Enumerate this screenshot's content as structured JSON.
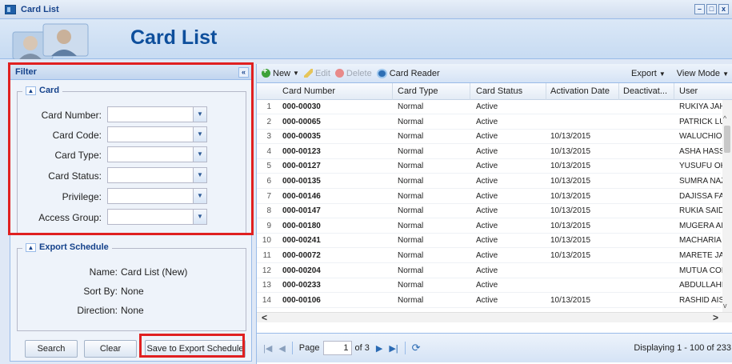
{
  "window": {
    "title": "Card List",
    "icon": "card-list-app-icon",
    "buttons": [
      "–",
      "□",
      "x"
    ]
  },
  "header": {
    "heading": "Card List"
  },
  "filter_panel": {
    "title": "Filter",
    "collapse_glyph": "«",
    "card_section": {
      "legend": "Card",
      "fields": [
        {
          "label": "Card Number:",
          "value": ""
        },
        {
          "label": "Card Code:",
          "value": ""
        },
        {
          "label": "Card Type:",
          "value": ""
        },
        {
          "label": "Card Status:",
          "value": ""
        },
        {
          "label": "Privilege:",
          "value": ""
        },
        {
          "label": "Access Group:",
          "value": ""
        }
      ]
    },
    "export_section": {
      "legend": "Export Schedule",
      "name_label": "Name:",
      "name_value": "Card List (New)",
      "sort_label": "Sort By:",
      "sort_value": "None",
      "direction_label": "Direction:",
      "direction_value": "None"
    },
    "buttons": {
      "search": "Search",
      "clear": "Clear",
      "save_export": "Save to Export Schedule"
    }
  },
  "toolbar": {
    "new": "New",
    "edit": "Edit",
    "delete": "Delete",
    "card_reader": "Card Reader",
    "export": "Export",
    "view_mode": "View Mode"
  },
  "grid": {
    "columns": [
      "Card Number",
      "Card Type",
      "Card Status",
      "Activation Date",
      "Deactivat...",
      "User"
    ],
    "rows": [
      {
        "n": "1",
        "card": "000-00030",
        "type": "Normal",
        "status": "Active",
        "activation": "",
        "deactivation": "",
        "user": "RUKIYA JAH"
      },
      {
        "n": "2",
        "card": "000-00065",
        "type": "Normal",
        "status": "Active",
        "activation": "",
        "deactivation": "",
        "user": "PATRICK LU"
      },
      {
        "n": "3",
        "card": "000-00035",
        "type": "Normal",
        "status": "Active",
        "activation": "10/13/2015",
        "deactivation": "",
        "user": "WALUCHIO"
      },
      {
        "n": "4",
        "card": "000-00123",
        "type": "Normal",
        "status": "Active",
        "activation": "10/13/2015",
        "deactivation": "",
        "user": "ASHA HASS"
      },
      {
        "n": "5",
        "card": "000-00127",
        "type": "Normal",
        "status": "Active",
        "activation": "10/13/2015",
        "deactivation": "",
        "user": "YUSUFU OK"
      },
      {
        "n": "6",
        "card": "000-00135",
        "type": "Normal",
        "status": "Active",
        "activation": "10/13/2015",
        "deactivation": "",
        "user": "SUMRA NAZ"
      },
      {
        "n": "7",
        "card": "000-00146",
        "type": "Normal",
        "status": "Active",
        "activation": "10/13/2015",
        "deactivation": "",
        "user": "DAJISSA FA"
      },
      {
        "n": "8",
        "card": "000-00147",
        "type": "Normal",
        "status": "Active",
        "activation": "10/13/2015",
        "deactivation": "",
        "user": "RUKIA SAID"
      },
      {
        "n": "9",
        "card": "000-00180",
        "type": "Normal",
        "status": "Active",
        "activation": "10/13/2015",
        "deactivation": "",
        "user": "MUGERA AI"
      },
      {
        "n": "10",
        "card": "000-00241",
        "type": "Normal",
        "status": "Active",
        "activation": "10/13/2015",
        "deactivation": "",
        "user": "MACHARIA"
      },
      {
        "n": "11",
        "card": "000-00072",
        "type": "Normal",
        "status": "Active",
        "activation": "10/13/2015",
        "deactivation": "",
        "user": "MARETE JA"
      },
      {
        "n": "12",
        "card": "000-00204",
        "type": "Normal",
        "status": "Active",
        "activation": "",
        "deactivation": "",
        "user": "MUTUA COI"
      },
      {
        "n": "13",
        "card": "000-00233",
        "type": "Normal",
        "status": "Active",
        "activation": "",
        "deactivation": "",
        "user": "ABDULLAHI"
      },
      {
        "n": "14",
        "card": "000-00106",
        "type": "Normal",
        "status": "Active",
        "activation": "10/13/2015",
        "deactivation": "",
        "user": "RASHID AIS"
      }
    ]
  },
  "pager": {
    "page_label": "Page",
    "page_value": "1",
    "of_label": "of 3",
    "display": "Displaying 1 - 100 of 233"
  },
  "colors": {
    "highlight": "#e02020",
    "heading": "#0e4f9c",
    "panel_title": "#15428b"
  }
}
